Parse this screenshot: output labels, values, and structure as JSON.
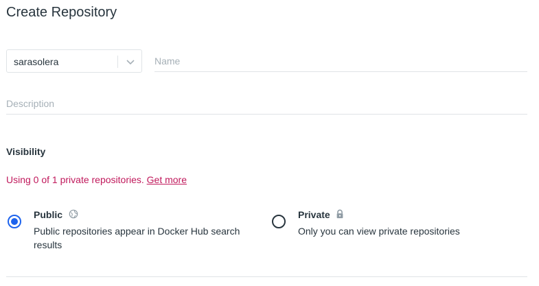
{
  "page": {
    "title": "Create Repository"
  },
  "form": {
    "namespace_value": "sarasolera",
    "name_placeholder": "Name",
    "description_placeholder": "Description"
  },
  "visibility": {
    "heading": "Visibility",
    "usage_text": "Using 0 of 1 private repositories.",
    "usage_link": "Get more",
    "options": [
      {
        "title": "Public",
        "description": "Public repositories appear in Docker Hub search results",
        "icon": "globe-icon",
        "selected": true
      },
      {
        "title": "Private",
        "description": "Only you can view private repositories",
        "icon": "lock-icon",
        "selected": false
      }
    ]
  },
  "colors": {
    "accent": "#1d63ed",
    "warning_text": "#c0185b",
    "border": "#dfe3e6",
    "placeholder": "#a6b0b7"
  }
}
